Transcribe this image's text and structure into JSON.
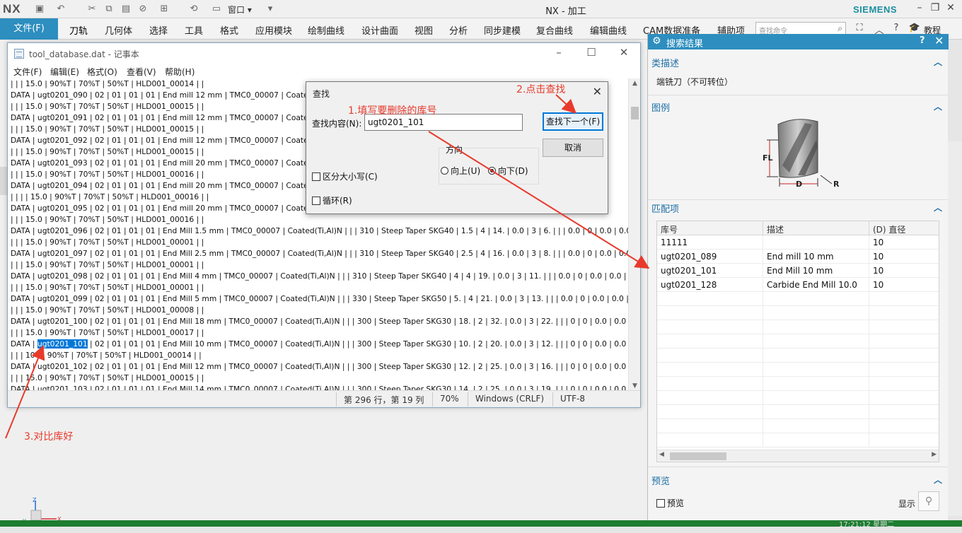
{
  "nx": {
    "logo": "NX",
    "window_menu": "窗口",
    "title": "NX - 加工",
    "brand": "SIEMENS",
    "file_tab": "文件(F)",
    "tabs": [
      "刀轨",
      "几何体",
      "选择",
      "工具",
      "格式",
      "应用模块",
      "绘制曲线",
      "设计曲面",
      "视图",
      "分析",
      "同步建模",
      "复合曲线",
      "编辑曲线",
      "CAM数据准备",
      "辅助项"
    ],
    "search_placeholder": "查找命令",
    "tutorial": "教程"
  },
  "notepad": {
    "title": "tool_database.dat - 记事本",
    "menu": [
      "文件(F)",
      "编辑(E)",
      "格式(O)",
      "查看(V)",
      "帮助(H)"
    ],
    "lines": [
      "| | | 15.0 | 90%T | 70%T | 50%T | HLD001_00014 | |",
      "DATA | ugt0201_090 | 02 | 01 | 01 | 01 | End mill 12 mm | TMC0_00007 | Coated(Ti,A",
      "| | | 15.0 | 90%T | 70%T | 50%T | HLD001_00015 | |",
      "DATA | ugt0201_091 | 02 | 01 | 01 | 01 | End mill 12 mm | TMC0_00007 | Coated(Ti,A",
      "| | | 15.0 | 90%T | 70%T | 50%T | HLD001_00015 | |",
      "DATA | ugt0201_092 | 02 | 01 | 01 | 01 | End mill 12 mm | TMC0_00007 | Coated(Ti,A",
      "| | | 15.0 | 90%T | 70%T | 50%T | HLD001_00015 | |",
      "DATA | ugt0201_093 | 02 | 01 | 01 | 01 | End mill 20 mm | TMC0_00007 | Coated(Ti,A",
      "| | | 15.0 | 90%T | 70%T | 50%T | HLD001_00016 | |",
      "DATA | ugt0201_094 | 02 | 01 | 01 | 01 | End mill 20 mm | TMC0_00007 | Coated(Ti,A",
      "| | | | 15.0 | 90%T | 70%T | 50%T | HLD001_00016 | |",
      "DATA | ugt0201_095 | 02 | 01 | 01 | 01 | End mill 20 mm | TMC0_00007 | Coated(Ti,A",
      "| | | 15.0 | 90%T | 70%T | 50%T | HLD001_00016 | |",
      "DATA | ugt0201_096 | 02 | 01 | 01 | 01 | End Mill 1.5 mm | TMC0_00007 | Coated(Ti,Al)N | | | 310 | Steep Taper SKG40 | 1.5 | 4 | 14. | 0.0 | 3 | 6. | | | 0.0 | 0 | 0.0 | 0.0 | 1.0 |",
      "| | | 15.0 | 90%T | 70%T | 50%T | HLD001_00001 | |",
      "DATA | ugt0201_097 | 02 | 01 | 01 | 01 | End Mill 2.5 mm | TMC0_00007 | Coated(Ti,Al)N | | | 310 | Steep Taper SKG40 | 2.5 | 4 | 16. | 0.0 | 3 | 8. | | | 0.0 | 0 | 0.0 | 0.0 | 1.0 |",
      "| | | 15.0 | 90%T | 70%T | 50%T | HLD001_00001 | |",
      "DATA | ugt0201_098 | 02 | 01 | 01 | 01 | End Mill 4 mm | TMC0_00007 | Coated(Ti,Al)N | | | 310 | Steep Taper SKG40 | 4 | 4 | 19. | 0.0 | 3 | 11. | | | 0.0 | 0 | 0.0 | 0.0 | 1.0 |",
      "| | | 15.0 | 90%T | 70%T | 50%T | HLD001_00001 | |",
      "DATA | ugt0201_099 | 02 | 01 | 01 | 01 | End Mill 5 mm | TMC0_00007 | Coated(Ti,Al)N | | | 330 | Steep Taper SKG50 | 5. | 4 | 21. | 0.0 | 3 | 13. | | | 0.0 | 0 | 0.0 | 0.0 | 1.0 |",
      "| | | 15.0 | 90%T | 70%T | 50%T | HLD001_00008 | |",
      "DATA | ugt0201_100 | 02 | 01 | 01 | 01 | End Mill 18 mm | TMC0_00007 | Coated(Ti,Al)N | | | 300 | Steep Taper SKG30 | 18. | 2 | 32. | 0.0 | 3 | 22. | | | 0 | 0 | 0.0 | 0.0 | 1.0 |",
      "| | | 15.0 | 90%T | 70%T | 50%T | HLD001_00017 | |"
    ],
    "selected_line": {
      "pre": "DATA | ",
      "sel": "ugt0201_101",
      "post": " | 02 | 01 | 01 | 01 | End Mill 10 mm | TMC0_00007 | Coated(Ti,Al)N | | | 300 | Steep Taper SKG30 | 10. | 2 | 20. | 0.0 | 3 | 12. | | | 0 | 0 | 0.0 | 0.0 | 1.0 |"
    },
    "lines_after": [
      "| | | 100 | 90%T | 70%T | 50%T | HLD001_00014 | |",
      "DATA | ugt0201_102 | 02 | 01 | 01 | 01 | End Mill 12 mm | TMC0_00007 | Coated(Ti,Al)N | | | 300 | Steep Taper SKG30 | 12. | 2 | 25. | 0.0 | 3 | 16. | | | 0 | 0 | 0.0 | 0.0 | 1.0 |",
      "| | | 15.0 | 90%T | 70%T | 50%T | HLD001_00015 | |",
      "DATA | ugt0201_103 | 02 | 01 | 01 | 01 | End Mill 14 mm | TMC0_00007 | Coated(Ti,Al)N | | | 300 | Steep Taper SKG30 | 14. | 2 | 25. | 0.0 | 3 | 19. | | | 0 | 0 | 0.0 | 0.0 | 1.0 |"
    ],
    "clipped_suffix": "1.0 |",
    "status": {
      "position": "第 296 行，第 19 列",
      "zoom": "70%",
      "eol": "Windows (CRLF)",
      "encoding": "UTF-8"
    }
  },
  "find": {
    "title": "查找",
    "label": "查找内容(N):",
    "value": "ugt0201_101",
    "find_next": "查找下一个(F)",
    "cancel": "取消",
    "direction": "方向",
    "up": "向上(U)",
    "down": "向下(D)",
    "match_case": "区分大小写(C)",
    "wrap": "循环(R)"
  },
  "panel": {
    "title": "搜索结果",
    "class_desc_title": "类描述",
    "class_desc": "端铣刀（不可转位）",
    "legend_title": "图例",
    "legend_labels": {
      "fl": "FL",
      "d": "D",
      "r": "R"
    },
    "matches_title": "匹配项",
    "columns": [
      "库号",
      "描述",
      "(D) 直径"
    ],
    "rows": [
      [
        "11111",
        "",
        "10"
      ],
      [
        "ugt0201_089",
        "End mill 10 mm",
        "10"
      ],
      [
        "ugt0201_101",
        "End Mill 10 mm",
        "10"
      ],
      [
        "ugt0201_128",
        "Carbide End Mill 10.0",
        "10"
      ]
    ],
    "preview_title": "预览",
    "preview_check": "预览",
    "show": "显示"
  },
  "annotations": {
    "a1": "1.填写要删除的库号",
    "a2": "2.点击查找",
    "a3": "3.对比库好"
  },
  "taskbar": {
    "clock": "17:21:12 星期二"
  },
  "colors": {
    "accent": "#2d8ebf",
    "annotation": "#e83a2c",
    "selection": "#0078d7"
  }
}
